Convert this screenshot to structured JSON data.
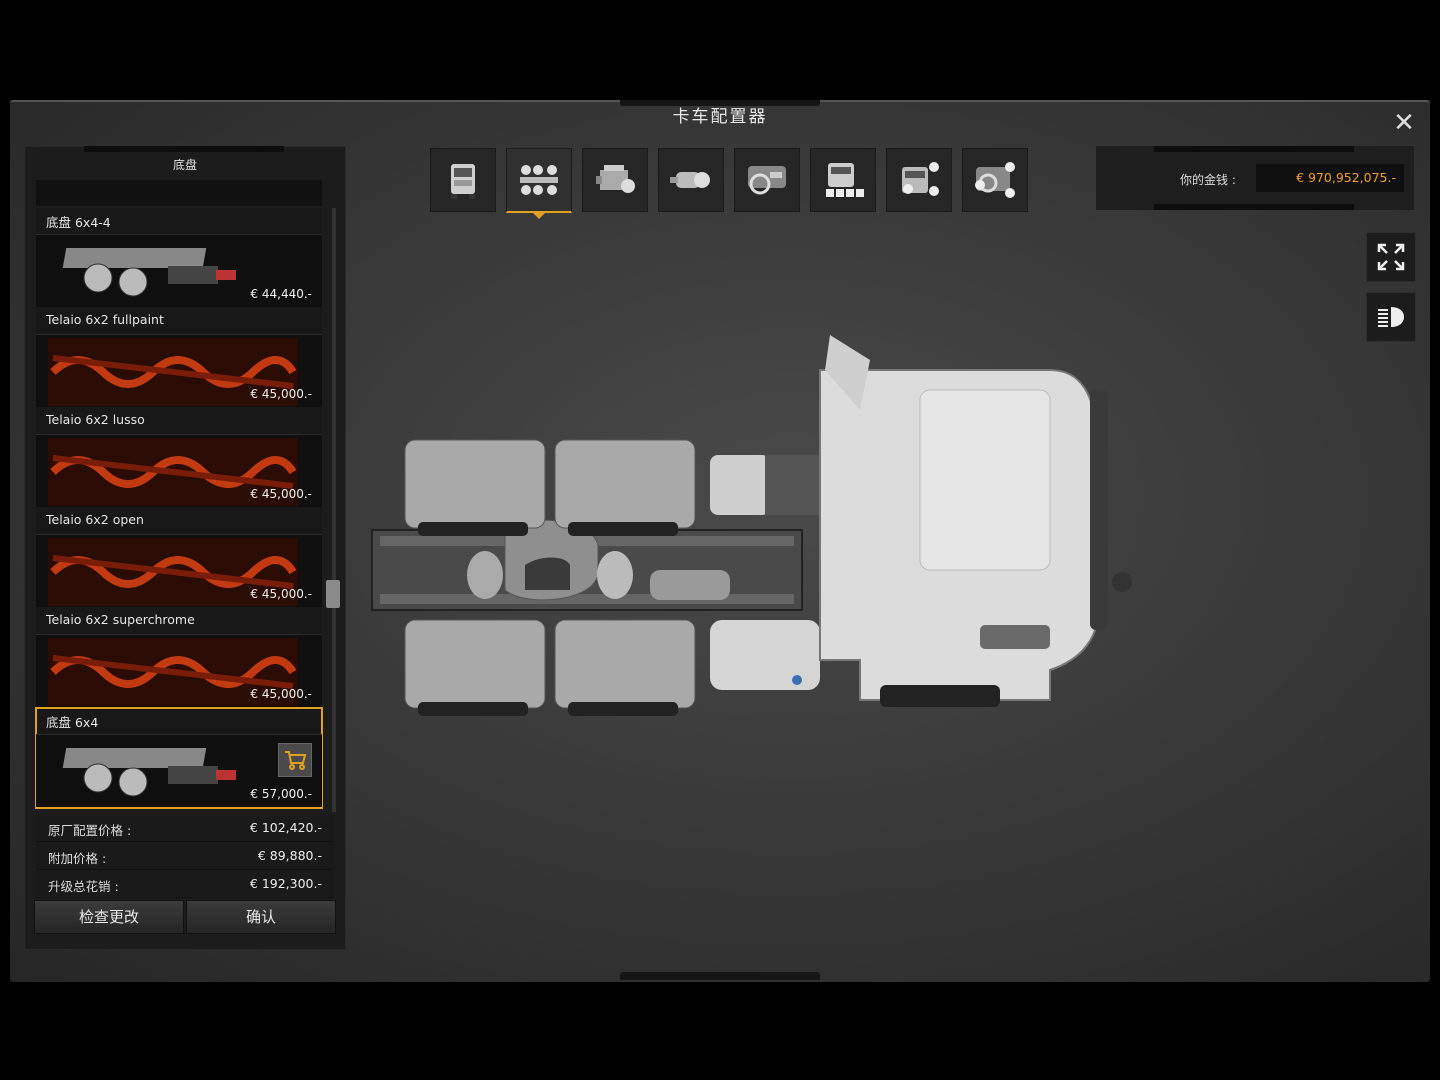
{
  "window": {
    "title": "卡车配置器",
    "close_icon": "close-icon"
  },
  "tabs": [
    {
      "icon": "truck-cab-icon",
      "active": false
    },
    {
      "icon": "chassis-icon",
      "active": true
    },
    {
      "icon": "engine-icon",
      "active": false
    },
    {
      "icon": "transmission-icon",
      "active": false
    },
    {
      "icon": "interior-icon",
      "active": false
    },
    {
      "icon": "cabin-icon",
      "active": false
    },
    {
      "icon": "exterior-accessories-icon",
      "active": false
    },
    {
      "icon": "interior-accessories-icon",
      "active": false
    }
  ],
  "money": {
    "label": "你的金钱 :",
    "value": "€ 970,952,075.-"
  },
  "left_panel": {
    "header": "底盘",
    "items": [
      {
        "label": "底盘 6x4-4",
        "price": "€ 44,440.-",
        "thumb": "chassis-thumb"
      },
      {
        "label": "Telaio 6x2 fullpaint",
        "price": "€ 45,000.-",
        "thumb": "placeholder-thumb"
      },
      {
        "label": "Telaio 6x2 lusso",
        "price": "€ 45,000.-",
        "thumb": "placeholder-thumb"
      },
      {
        "label": "Telaio 6x2 open",
        "price": "€ 45,000.-",
        "thumb": "placeholder-thumb"
      },
      {
        "label": "Telaio 6x2 superchrome",
        "price": "€ 45,000.-",
        "thumb": "placeholder-thumb"
      },
      {
        "label": "底盘 6x4",
        "price": "€ 57,000.-",
        "thumb": "chassis-thumb",
        "selected": true
      }
    ]
  },
  "summary": [
    {
      "label": "原厂配置价格 :",
      "value": "€ 102,420.-"
    },
    {
      "label": "附加价格 :",
      "value": "€ 89,880.-"
    },
    {
      "label": "升级总花销 :",
      "value": "€ 192,300.-"
    }
  ],
  "buttons": {
    "review": "检查更改",
    "confirm": "确认"
  },
  "side_buttons": {
    "fullscreen_icon": "fullscreen-icon",
    "lights_icon": "headlight-icon"
  },
  "colors": {
    "accent": "#e2a020",
    "money": "#f0a020"
  }
}
